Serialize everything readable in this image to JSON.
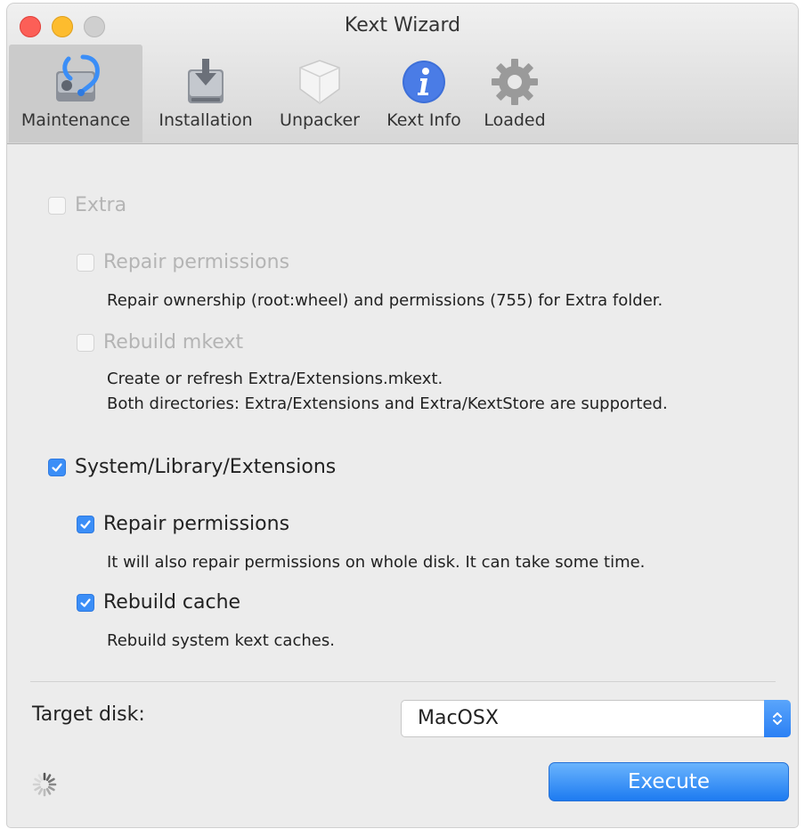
{
  "window": {
    "title": "Kext Wizard"
  },
  "toolbar": {
    "items": [
      {
        "label": "Maintenance",
        "icon": "maintenance-icon",
        "selected": true
      },
      {
        "label": "Installation",
        "icon": "installation-icon",
        "selected": false
      },
      {
        "label": "Unpacker",
        "icon": "unpacker-icon",
        "selected": false
      },
      {
        "label": "Kext Info",
        "icon": "info-icon",
        "selected": false
      },
      {
        "label": "Loaded",
        "icon": "gear-icon",
        "selected": false
      }
    ]
  },
  "extra": {
    "label": "Extra",
    "checked": false,
    "enabled": false,
    "repair_permissions": {
      "label": "Repair permissions",
      "checked": false,
      "description": "Repair ownership (root:wheel) and permissions (755) for Extra folder."
    },
    "rebuild_mkext": {
      "label": "Rebuild mkext",
      "checked": false,
      "description_line1": "Create or refresh Extra/Extensions.mkext.",
      "description_line2": "Both directories: Extra/Extensions and Extra/KextStore are supported."
    }
  },
  "sle": {
    "label": "System/Library/Extensions",
    "checked": true,
    "repair_permissions": {
      "label": "Repair permissions",
      "checked": true,
      "description": "It will also repair permissions on whole disk. It can take some time."
    },
    "rebuild_cache": {
      "label": "Rebuild cache",
      "checked": true,
      "description": "Rebuild system kext caches."
    }
  },
  "target": {
    "label": "Target disk:",
    "selected": "MacOSX"
  },
  "actions": {
    "execute_label": "Execute"
  },
  "colors": {
    "accent": "#3b8ef7",
    "close": "#fc5f57",
    "minimize": "#fdbc2e",
    "zoom_disabled": "#cfcfcf"
  }
}
